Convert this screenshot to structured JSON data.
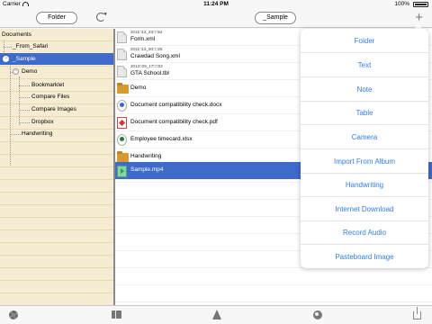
{
  "status_bar": {
    "carrier": "Carrier",
    "time": "11:24 PM",
    "battery": "100%"
  },
  "left_nav": {
    "folder_button": "Folder"
  },
  "right_nav": {
    "folder_button": "_Sample"
  },
  "tree": [
    {
      "label": "Documents"
    },
    {
      "label": "_From_Safari"
    },
    {
      "label": "_Sample",
      "toggle": "−"
    },
    {
      "label": "Demo",
      "toggle": "−"
    },
    {
      "label": "Bookmarklet"
    },
    {
      "label": "Compare Files"
    },
    {
      "label": "Compare Images"
    },
    {
      "label": "Dropbox"
    },
    {
      "label": "Handwriting"
    }
  ],
  "files": [
    {
      "date": "2011□12_23□□54",
      "name": "Form.xml",
      "icon": "document-icon"
    },
    {
      "date": "2011□13_00□□25",
      "name": "Crawdad Song.xml",
      "icon": "document-icon"
    },
    {
      "date": "2012□29_17□□03",
      "name": "GTA School.tbl",
      "icon": "document-icon"
    },
    {
      "name": "Demo",
      "icon": "folder-icon"
    },
    {
      "name": "Document compatibility check.docx",
      "icon": "word-icon"
    },
    {
      "name": "Document compatibility check.pdf",
      "icon": "pdf-icon"
    },
    {
      "name": "Employee timecard.xlsx",
      "icon": "excel-icon"
    },
    {
      "name": "Handwriting",
      "icon": "folder-icon"
    },
    {
      "name": "Sample.mp4",
      "icon": "video-icon"
    }
  ],
  "popover": {
    "items": [
      "Folder",
      "Text",
      "Note",
      "Table",
      "Camera",
      "Import From Album",
      "Handwriting",
      "Internet Download",
      "Record Audio",
      "Pasteboard Image"
    ]
  },
  "toolbar": {
    "icons": [
      "gear-icon",
      "book-icon",
      "tree-icon",
      "globe-icon",
      "share-icon"
    ]
  },
  "colors": {
    "selection": "#3e6bc9",
    "accent": "#2f7df6",
    "tree_background": "#f6ecd3"
  }
}
